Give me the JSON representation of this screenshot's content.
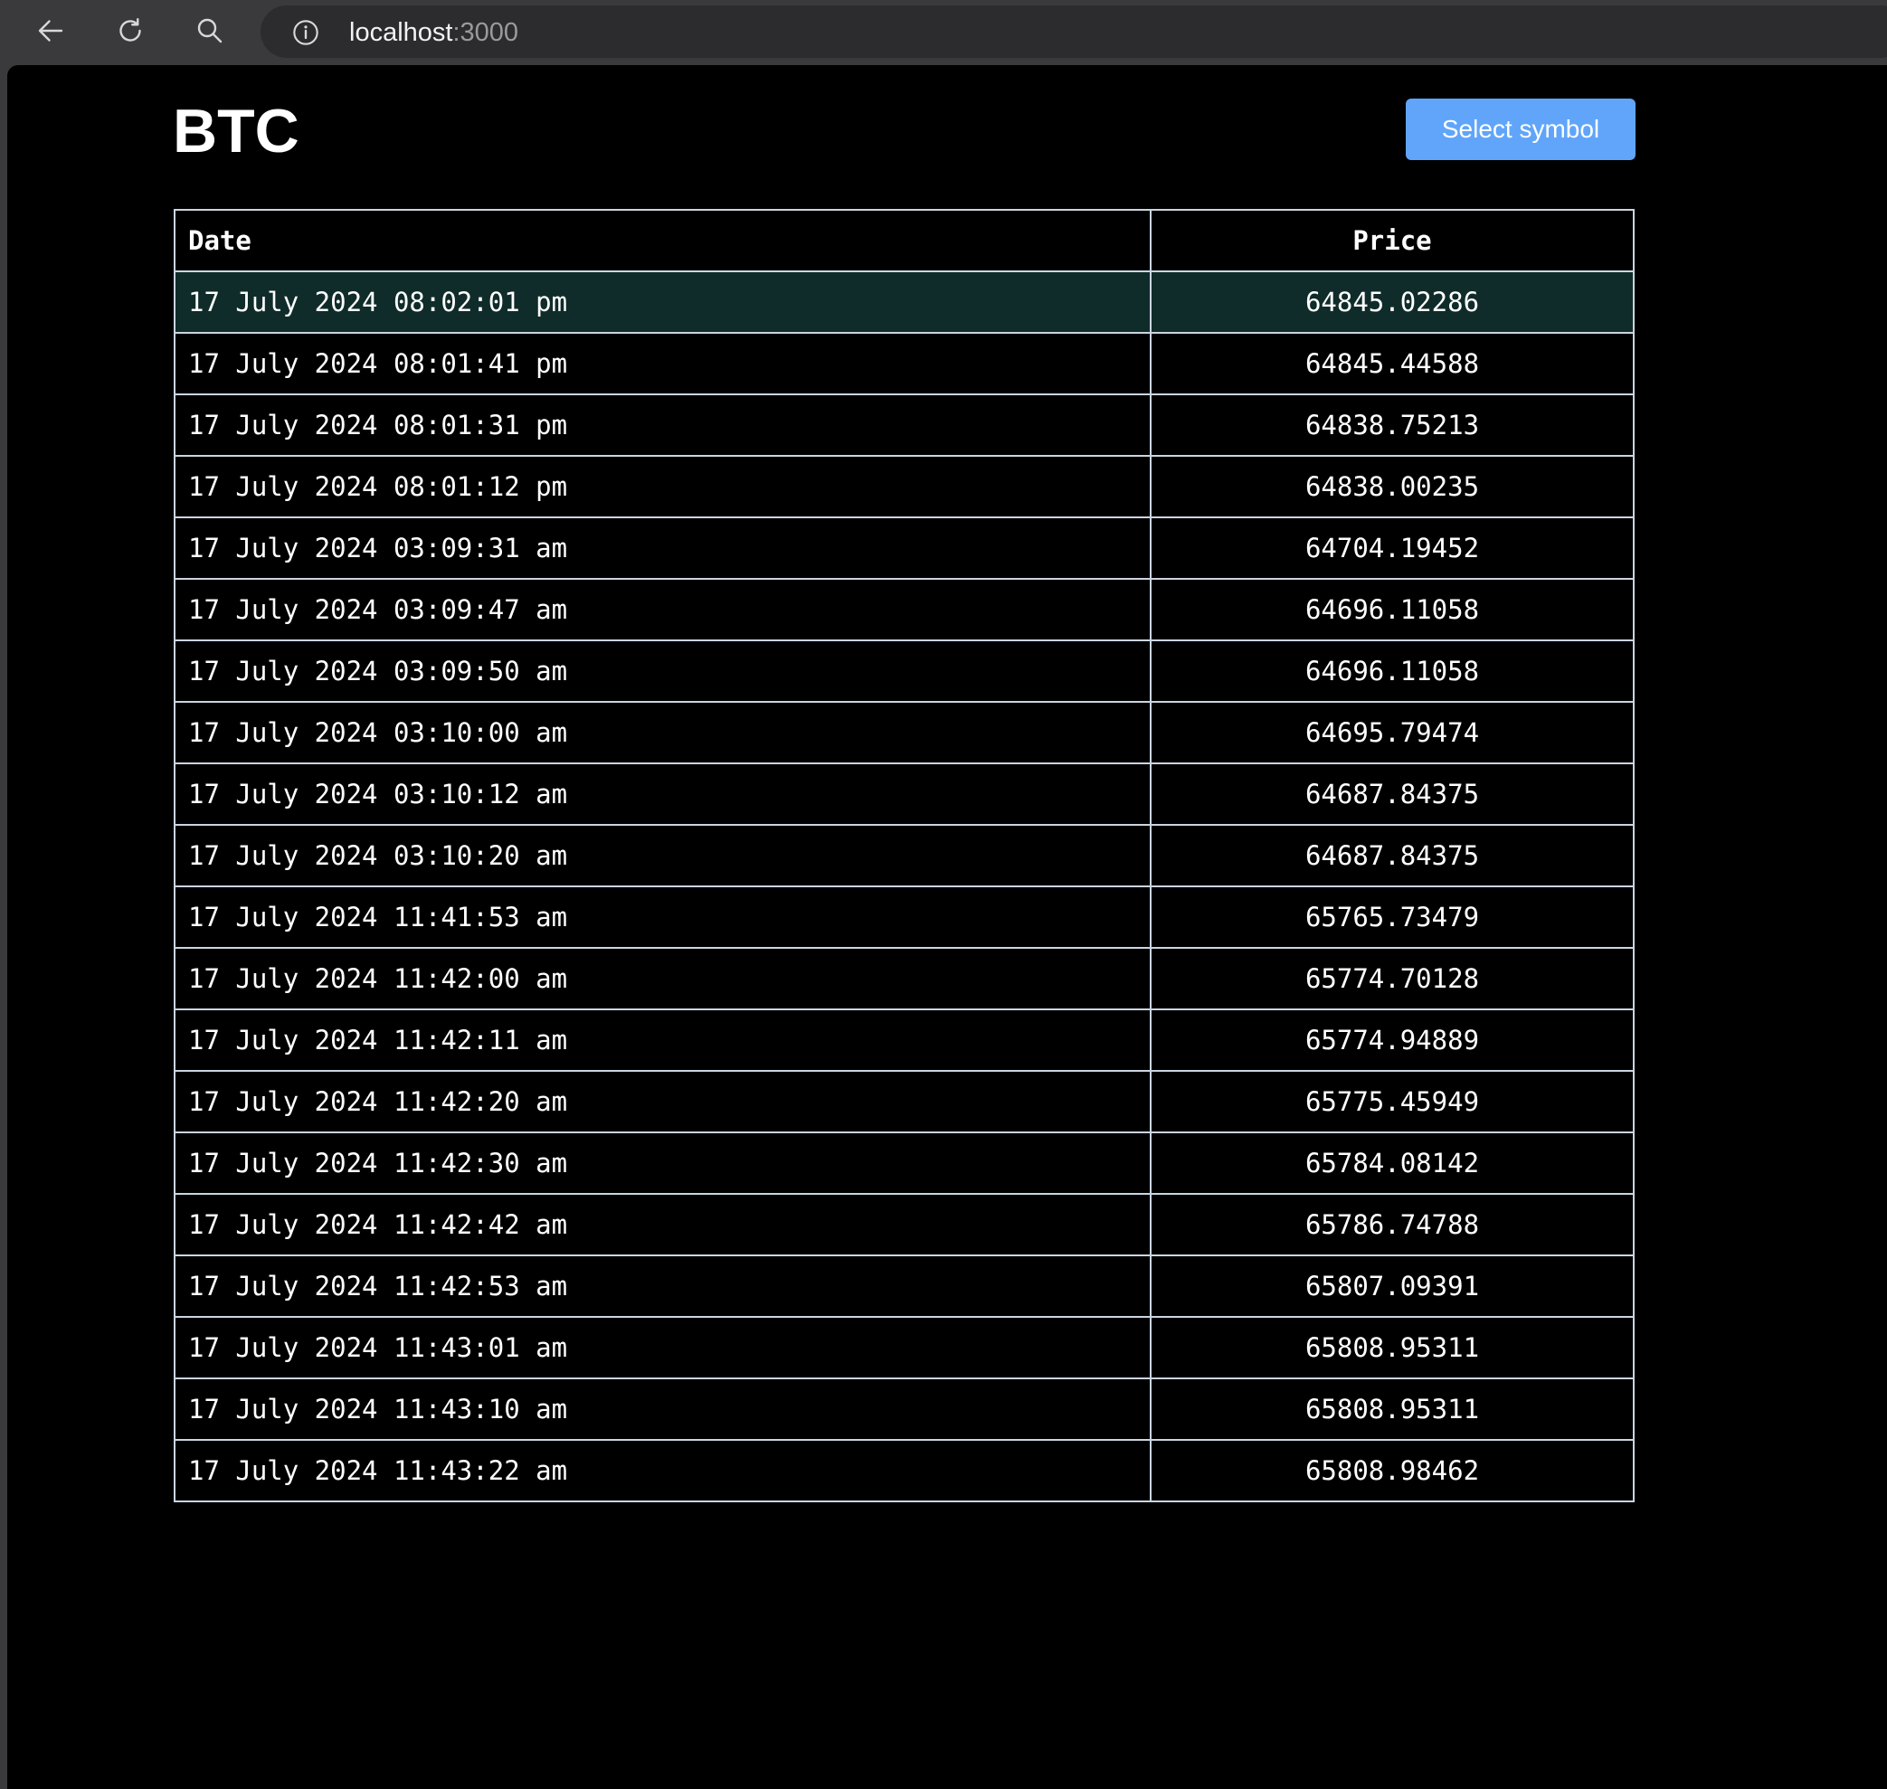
{
  "browser": {
    "url_host": "localhost",
    "url_port": ":3000",
    "icons": {
      "back": "arrow-left-icon",
      "reload": "reload-icon",
      "search": "search-icon",
      "info": "info-icon"
    }
  },
  "page": {
    "title": "BTC",
    "select_button_label": "Select symbol"
  },
  "table": {
    "headers": {
      "date": "Date",
      "price": "Price"
    },
    "rows": [
      {
        "date": "17 July 2024 08:02:01 pm",
        "price": "64845.02286",
        "highlighted": true
      },
      {
        "date": "17 July 2024 08:01:41 pm",
        "price": "64845.44588"
      },
      {
        "date": "17 July 2024 08:01:31 pm",
        "price": "64838.75213"
      },
      {
        "date": "17 July 2024 08:01:12 pm",
        "price": "64838.00235"
      },
      {
        "date": "17 July 2024 03:09:31 am",
        "price": "64704.19452"
      },
      {
        "date": "17 July 2024 03:09:47 am",
        "price": "64696.11058"
      },
      {
        "date": "17 July 2024 03:09:50 am",
        "price": "64696.11058"
      },
      {
        "date": "17 July 2024 03:10:00 am",
        "price": "64695.79474"
      },
      {
        "date": "17 July 2024 03:10:12 am",
        "price": "64687.84375"
      },
      {
        "date": "17 July 2024 03:10:20 am",
        "price": "64687.84375"
      },
      {
        "date": "17 July 2024 11:41:53 am",
        "price": "65765.73479"
      },
      {
        "date": "17 July 2024 11:42:00 am",
        "price": "65774.70128"
      },
      {
        "date": "17 July 2024 11:42:11 am",
        "price": "65774.94889"
      },
      {
        "date": "17 July 2024 11:42:20 am",
        "price": "65775.45949"
      },
      {
        "date": "17 July 2024 11:42:30 am",
        "price": "65784.08142"
      },
      {
        "date": "17 July 2024 11:42:42 am",
        "price": "65786.74788"
      },
      {
        "date": "17 July 2024 11:42:53 am",
        "price": "65807.09391"
      },
      {
        "date": "17 July 2024 11:43:01 am",
        "price": "65808.95311"
      },
      {
        "date": "17 July 2024 11:43:10 am",
        "price": "65808.95311"
      },
      {
        "date": "17 July 2024 11:43:22 am",
        "price": "65808.98462"
      }
    ]
  },
  "colors": {
    "page_background": "#000000",
    "button_background": "#60a5fa",
    "highlight_row": "#0f2c2a",
    "table_border": "#cbd5e1"
  }
}
